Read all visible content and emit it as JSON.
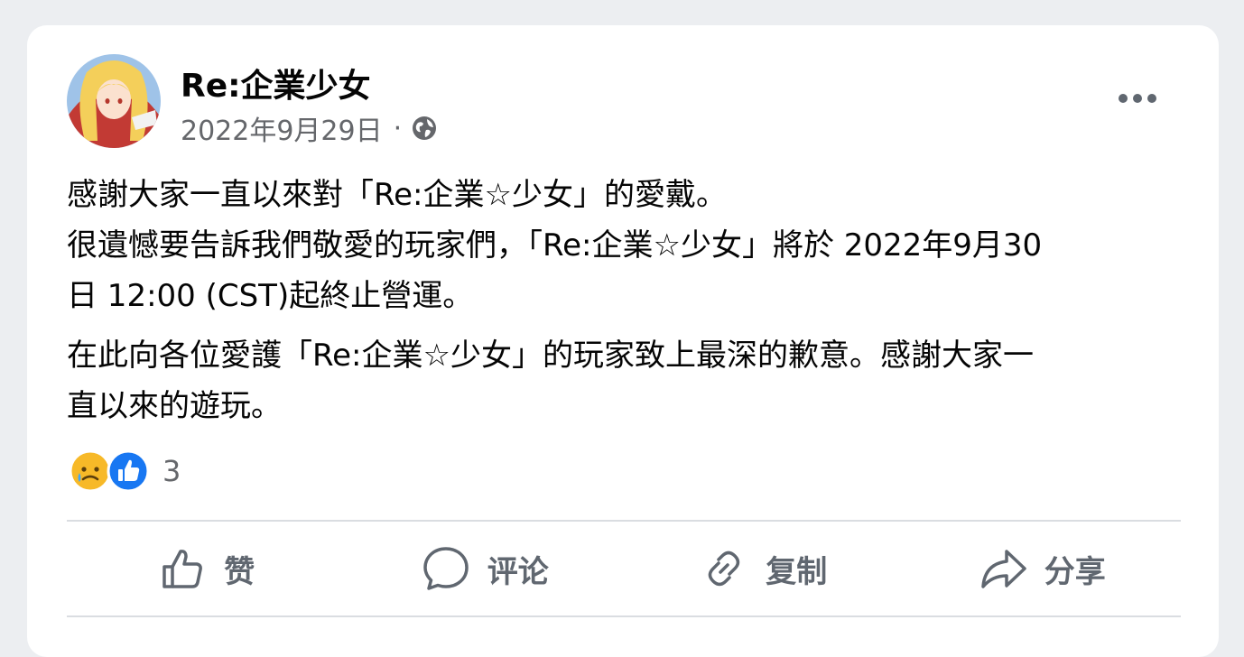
{
  "post": {
    "author": "Re:企業少女",
    "date": "2022年9月29日",
    "separator": "·",
    "privacy_icon": "globe-icon",
    "more_icon": "more-options-icon",
    "paragraphs": [
      [
        "感謝大家一直以來對「Re:企業☆少女」的愛戴。",
        "很遺憾要告訴我們敬愛的玩家們，「Re:企業☆少女」將於 2022年9月30",
        "日 12:00 (CST)起終止營運。"
      ],
      [
        "在此向各位愛護「Re:企業☆少女」的玩家致上最深的歉意。感謝大家一",
        "直以來的遊玩。"
      ]
    ],
    "reactions": {
      "icons": [
        "sad-crying-face-icon",
        "like-thumb-icon"
      ],
      "count": "3"
    }
  },
  "actions": {
    "like_label": "赞",
    "comment_label": "评论",
    "copy_label": "复制",
    "share_label": "分享"
  },
  "colors": {
    "page_bg": "#eceef1",
    "card_bg": "#ffffff",
    "primary_text": "#050505",
    "secondary_text": "#65676b",
    "like_blue": "#1877f2",
    "emoji_yellow": "#f7b928",
    "divider": "#dadde1"
  }
}
